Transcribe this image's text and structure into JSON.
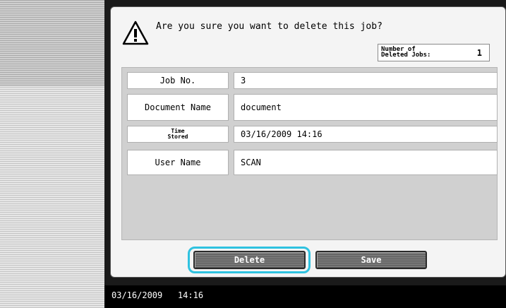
{
  "dialog": {
    "message": "Are you sure you want to delete this job?",
    "counter": {
      "label": "Number of\nDeleted Jobs:",
      "value": "1"
    }
  },
  "job_info": {
    "rows": [
      {
        "label": "Job No.",
        "value": "3"
      },
      {
        "label": "Document Name",
        "value": "document"
      },
      {
        "label": "Time\nStored",
        "value": "03/16/2009  14:16"
      },
      {
        "label": "User Name",
        "value": "SCAN"
      }
    ]
  },
  "buttons": {
    "delete_label": "Delete",
    "save_label": "Save"
  },
  "status_bar": {
    "datetime": "03/16/2009   14:16"
  },
  "colors": {
    "focus_ring": "#2fc2e0",
    "button_fill": "#6a6a6a",
    "panel_bg": "#d0d0d0"
  },
  "icons": {
    "warning": "warning-triangle-icon"
  }
}
